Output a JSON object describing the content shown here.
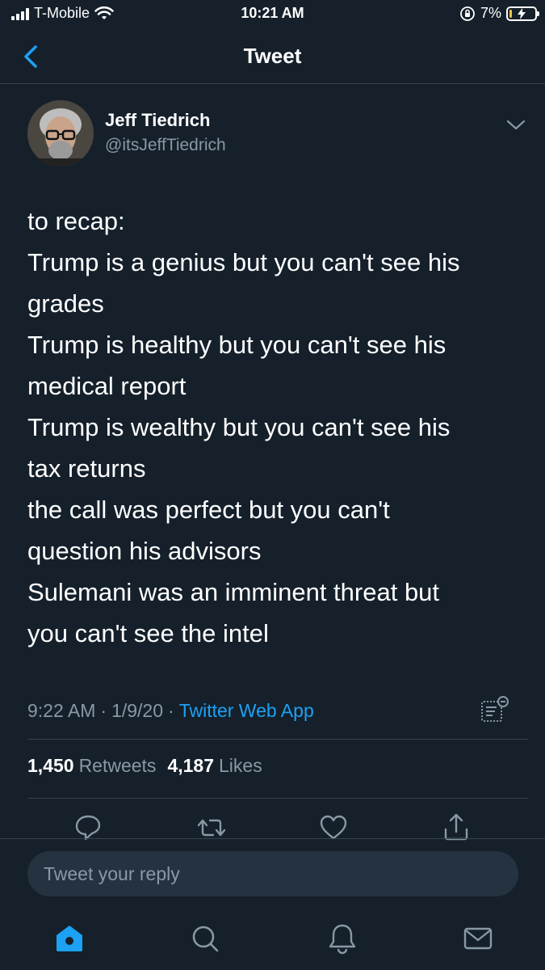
{
  "status_bar": {
    "carrier": "T-Mobile",
    "time": "10:21 AM",
    "battery_percent": "7%",
    "battery_level": 0.07
  },
  "header": {
    "title": "Tweet"
  },
  "tweet": {
    "author": {
      "name": "Jeff Tiedrich",
      "handle": "@itsJeffTiedrich"
    },
    "lines": [
      "to recap:",
      "Trump is a genius but you can't see his",
      "grades",
      "Trump is healthy but you can't see his",
      "medical report",
      "Trump is wealthy but you can't see his",
      "tax returns",
      "the call was perfect but you can't",
      "question his advisors",
      "Sulemani was an imminent threat but",
      "you can't see the intel"
    ],
    "time": "9:22 AM",
    "date": "1/9/20",
    "separator": "·",
    "source": "Twitter Web App",
    "retweets": "1,450",
    "retweets_label": "Retweets",
    "likes": "4,187",
    "likes_label": "Likes"
  },
  "reply": {
    "placeholder": "Tweet your reply"
  },
  "colors": {
    "background": "#15202b",
    "accent": "#1da1f2",
    "secondary_text": "#8899a6",
    "divider": "#38444d"
  },
  "icons": {
    "back": "chevron-left-icon",
    "more": "chevron-down-icon",
    "analytics": "analytics-icon",
    "reply": "reply-icon",
    "retweet": "retweet-icon",
    "like": "heart-icon",
    "share": "share-icon",
    "tabs": [
      "home-icon",
      "search-icon",
      "notifications-icon",
      "messages-icon"
    ]
  }
}
